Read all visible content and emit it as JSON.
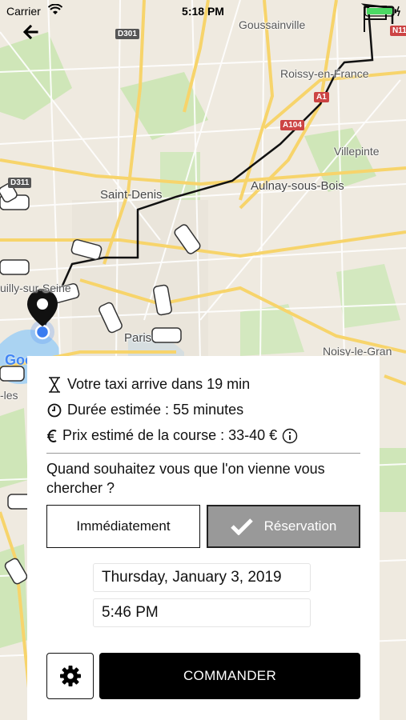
{
  "status_bar": {
    "carrier": "Carrier",
    "time": "5:18 PM"
  },
  "map": {
    "labels": {
      "goussainville": "Goussainville",
      "roissy": "Roissy-en-France",
      "villepinte": "Villepinte",
      "saint_denis": "Saint-Denis",
      "aulnay": "Aulnay-sous-Bois",
      "neuilly": "uilly-sur-Seine",
      "paris": "Paris",
      "noisy": "Noisy-le-Gran",
      "levallois": "-les"
    },
    "roads": {
      "d301": "D301",
      "a1": "A1",
      "a104": "A104",
      "d311": "D311",
      "n11": "N11"
    },
    "google_logo": "Goo"
  },
  "sheet": {
    "eta_text": "Votre taxi arrive dans 19 min",
    "duration_text": "Durée estimée : 55 minutes",
    "price_text": "Prix estimé de la course : 33-40 €",
    "question": "Quand souhaitez vous que l'on vienne vous chercher ?",
    "option_now": "Immédiatement",
    "option_reservation": "Réservation",
    "date_value": "Thursday, January 3, 2019",
    "time_value": "5:46 PM",
    "order_button": "COMMANDER"
  },
  "colors": {
    "accent": "#000000",
    "selected_option": "#999999",
    "route": "#111111"
  }
}
